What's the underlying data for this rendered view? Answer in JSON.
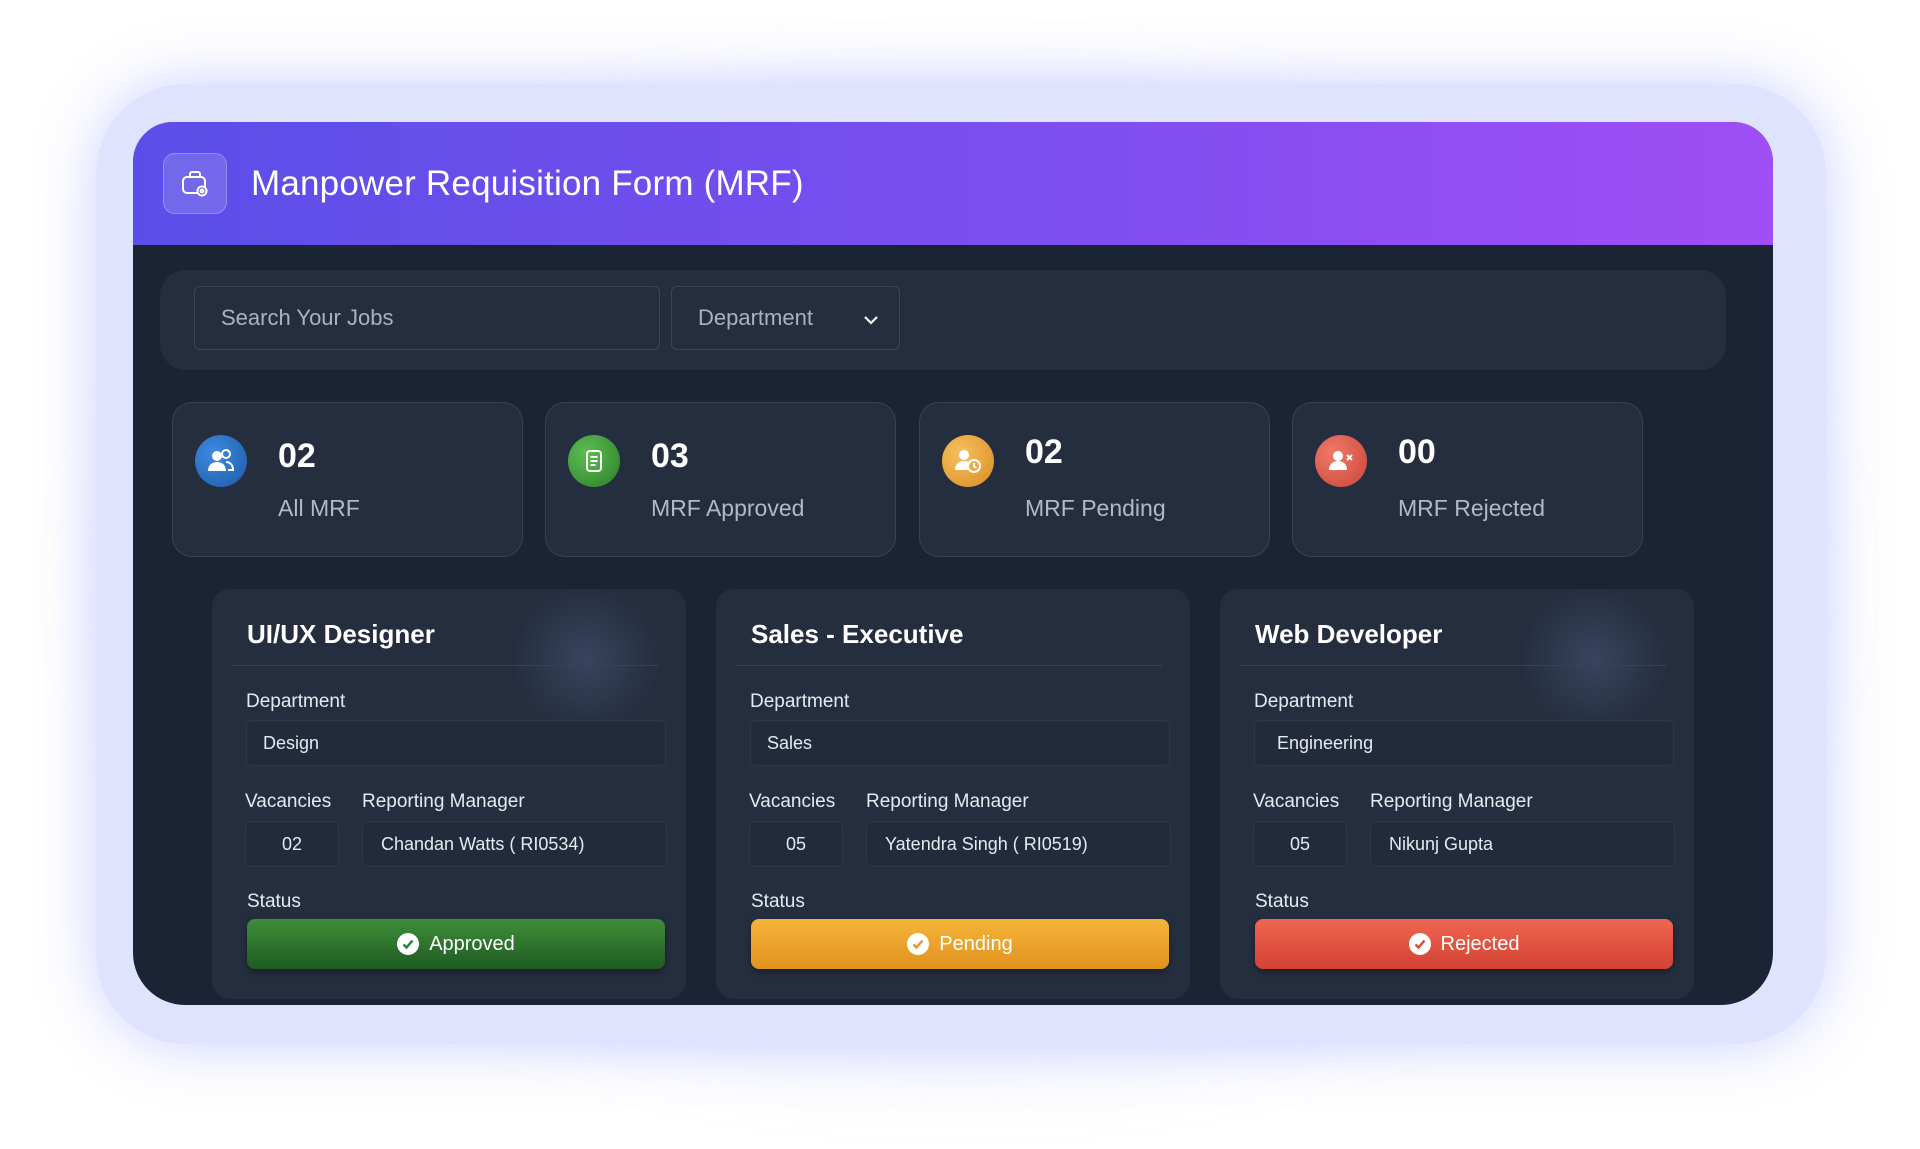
{
  "header": {
    "title": "Manpower Requisition Form (MRF)",
    "icon": "briefcase-gear-icon"
  },
  "toolbar": {
    "search_placeholder": "Search Your Jobs",
    "department_label": "Department"
  },
  "stats": [
    {
      "value": "02",
      "label": "All MRF",
      "icon": "users-icon",
      "color": "#2b6fc4"
    },
    {
      "value": "03",
      "label": "MRF Approved",
      "icon": "document-icon",
      "color": "#3f9c3a"
    },
    {
      "value": "02",
      "label": "MRF Pending",
      "icon": "user-clock-icon",
      "color": "#e2a12e"
    },
    {
      "value": "00",
      "label": "MRF Rejected",
      "icon": "user-remove-icon",
      "color": "#e05a4a"
    }
  ],
  "labels": {
    "department": "Department",
    "vacancies": "Vacancies",
    "reporting_manager": "Reporting Manager",
    "status": "Status"
  },
  "jobs": [
    {
      "title": "UI/UX Designer",
      "department": "Design",
      "vacancies": "02",
      "manager": "Chandan Watts ( RI0534)",
      "status": "Approved",
      "status_color": "#2e7d32"
    },
    {
      "title": "Sales - Executive",
      "department": "Sales",
      "vacancies": "05",
      "manager": "Yatendra Singh ( RI0519)",
      "status": "Pending",
      "status_color": "#f0a62a"
    },
    {
      "title": "Web Developer",
      "department": "Engineering",
      "vacancies": "05",
      "manager": "Nikunj Gupta",
      "status": "Rejected",
      "status_color": "#e0503c"
    }
  ]
}
